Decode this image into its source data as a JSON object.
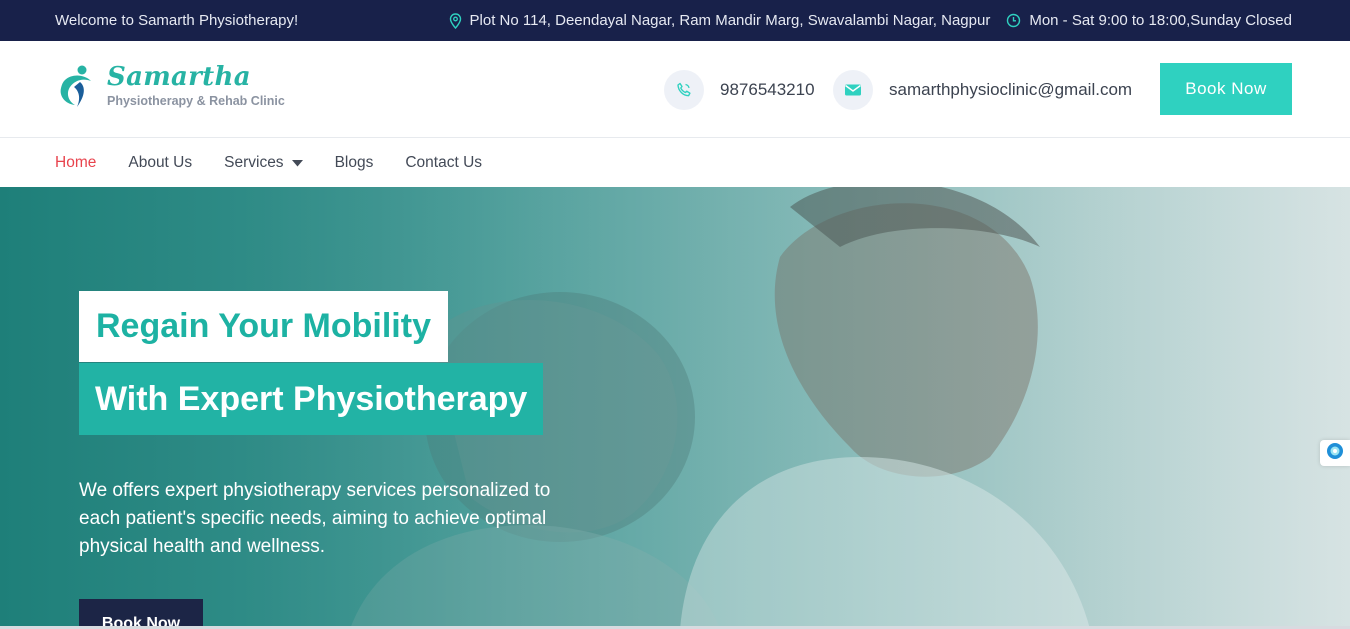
{
  "topbar": {
    "welcome": "Welcome to Samarth Physiotherapy!",
    "address": "Plot No 114, Deendayal Nagar, Ram Mandir Marg, Swavalambi Nagar, Nagpur",
    "hours": "Mon - Sat 9:00 to 18:00,Sunday Closed",
    "icons": {
      "address": "map-pin-icon",
      "hours": "clock-icon"
    }
  },
  "header": {
    "logo": {
      "brand": "Samartha",
      "tagline": "Physiotherapy & Rehab Clinic"
    },
    "phone": "9876543210",
    "email": "samarthphysioclinic@gmail.com",
    "book_label": "Book Now"
  },
  "nav": {
    "items": [
      {
        "label": "Home",
        "active": true
      },
      {
        "label": "About Us"
      },
      {
        "label": "Services",
        "has_dropdown": true
      },
      {
        "label": "Blogs"
      },
      {
        "label": "Contact Us"
      }
    ]
  },
  "hero": {
    "headline_line1": "Regain Your Mobility",
    "headline_line2": "With Expert Physiotherapy",
    "description": "We offers expert physiotherapy services personalized to each patient's specific needs, aiming to achieve optimal physical health and wellness.",
    "button_label": "Book Now"
  },
  "colors": {
    "topbar_bg": "#18214a",
    "accent": "#2fd1c0",
    "teal": "#22b3a5",
    "active_nav": "#e8434d",
    "dark_button": "#1c2546"
  }
}
